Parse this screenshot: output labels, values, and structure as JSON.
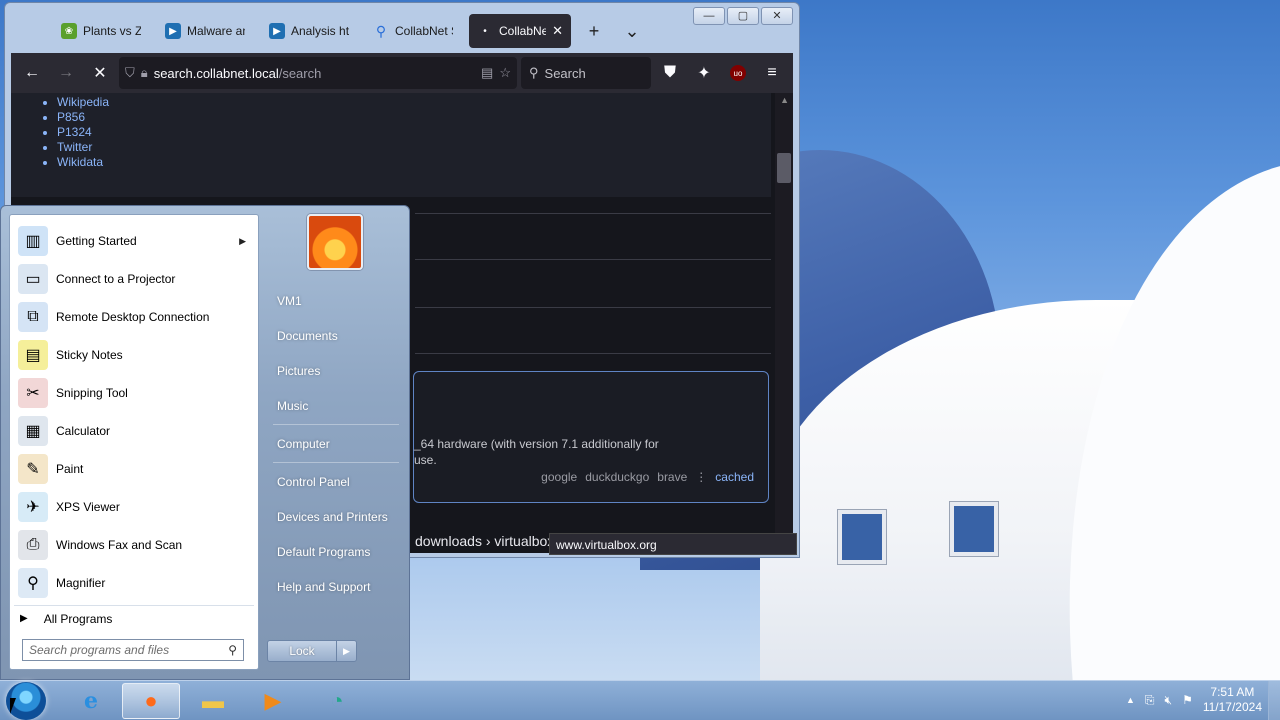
{
  "browser": {
    "tabs": [
      {
        "label": "Plants vs Zo",
        "icon": "plants-icon",
        "color": "#5aa02c"
      },
      {
        "label": "Malware an",
        "icon": "analysis-icon",
        "color": "#1f6fb2"
      },
      {
        "label": "Analysis htt",
        "icon": "analysis-icon",
        "color": "#1f6fb2"
      },
      {
        "label": "CollabNet S",
        "icon": "search-icon",
        "color": "#2a6fd8"
      },
      {
        "label": "CollabNe",
        "icon": "loading-dot-icon",
        "color": "#2b2a33"
      }
    ],
    "url_host": "search.collabnet.local",
    "url_path": "/search",
    "search_placeholder": "Search",
    "links": [
      "Wikipedia",
      "P856",
      "P1324",
      "Twitter",
      "Wikidata"
    ],
    "snippet_line1": "_64 hardware (with version 7.1 additionally for",
    "snippet_line2": "use.",
    "engines": [
      "google",
      "duckduckgo",
      "brave"
    ],
    "engines_sep": "⋮",
    "cached_label": "cached",
    "breadcrumb": "downloads › virtualbox",
    "status_url": "www.virtualbox.org"
  },
  "startmenu": {
    "programs": [
      {
        "label": "Getting Started",
        "icon": "getting-started-icon",
        "color": "#cfe3f7",
        "has_submenu": true
      },
      {
        "label": "Connect to a Projector",
        "icon": "projector-icon",
        "color": "#dbe6f2",
        "has_submenu": false
      },
      {
        "label": "Remote Desktop Connection",
        "icon": "remote-desktop-icon",
        "color": "#d5e4f5",
        "has_submenu": false
      },
      {
        "label": "Sticky Notes",
        "icon": "sticky-notes-icon",
        "color": "#f5ef9a",
        "has_submenu": false
      },
      {
        "label": "Snipping Tool",
        "icon": "snipping-tool-icon",
        "color": "#f2d7d7",
        "has_submenu": false
      },
      {
        "label": "Calculator",
        "icon": "calculator-icon",
        "color": "#dfe6ee",
        "has_submenu": false
      },
      {
        "label": "Paint",
        "icon": "paint-icon",
        "color": "#f4e6c9",
        "has_submenu": false
      },
      {
        "label": "XPS Viewer",
        "icon": "xps-viewer-icon",
        "color": "#d7ebf7",
        "has_submenu": false
      },
      {
        "label": "Windows Fax and Scan",
        "icon": "fax-scan-icon",
        "color": "#e2e5ea",
        "has_submenu": false
      },
      {
        "label": "Magnifier",
        "icon": "magnifier-icon",
        "color": "#dde9f5",
        "has_submenu": false
      }
    ],
    "all_programs": "All Programs",
    "search_placeholder": "Search programs and files",
    "places": [
      "VM1",
      "Documents",
      "Pictures",
      "Music",
      "Computer",
      "Control Panel",
      "Devices and Printers",
      "Default Programs",
      "Help and Support"
    ],
    "lock_label": "Lock"
  },
  "taskbar": {
    "apps": [
      {
        "name": "internet-explorer",
        "glyph": "e",
        "color": "#2a8fe0",
        "active": false
      },
      {
        "name": "firefox",
        "glyph": "●",
        "color": "#ff6a1a",
        "active": true
      },
      {
        "name": "explorer",
        "glyph": "▬",
        "color": "#f0c64a",
        "active": false
      },
      {
        "name": "media-player",
        "glyph": "▶",
        "color": "#f08a1a",
        "active": false
      },
      {
        "name": "network-app",
        "glyph": "◔",
        "color": "#22a88a",
        "active": false
      }
    ],
    "time": "7:51 AM",
    "date": "11/17/2024"
  }
}
